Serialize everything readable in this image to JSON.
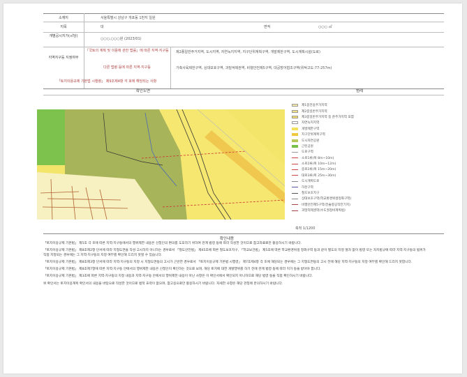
{
  "info": {
    "rows": [
      {
        "label": "소재지",
        "value": "서울특별시 강남구 개포동 1번지 일원"
      },
      {
        "label": "지목",
        "value": "대",
        "extra_label": "면적",
        "extra_value": "○○○ ㎡"
      },
      {
        "label": "개별공시지가(㎡당)",
        "value": "○○○,○○○원 (2023/01)"
      },
      {
        "label": "지역지구등 지정여부",
        "sublabels": [
          "「국토의 계획 및 이용에 관한 법률」에 따른 지역·지구등",
          "다른 법령 등에 따른 지역·지구등",
          "「토지이용규제 기본법 시행령」 제9조제4항 각 호에 해당되는 사항"
        ],
        "values": [
          "제2종일반주거지역, 도시지역, 자연녹지지역, 지구단위계획구역, 개발제한구역, 도시계획시설(도로)",
          "가축사육제한구역, 상대보호구역, 과밀억제권역, 비행안전제5구역, 대공방어협조구역(위탁고도:77-257m)"
        ]
      }
    ],
    "map_title": "확인도면",
    "legend_title": "범례"
  },
  "legend": [
    {
      "label": "제1종전용주거지역",
      "color": "#f4e9a8",
      "kind": "box"
    },
    {
      "label": "제2종일반주거지역",
      "color": "#f0e08a",
      "kind": "box"
    },
    {
      "label": "제3종일반주거지역 등 준주거지역 포함",
      "color": "#f8dc6a",
      "kind": "box"
    },
    {
      "label": "자연녹지지역",
      "color": "#ffffff",
      "kind": "box"
    },
    {
      "label": "개발제한구역",
      "color": "#f3e05c",
      "kind": "fill"
    },
    {
      "label": "지구단위계획구역",
      "color": "#f0c840",
      "kind": "fill"
    },
    {
      "label": "도시자연공원",
      "color": "#b8c85a",
      "kind": "fill"
    },
    {
      "label": "근린공원",
      "color": "#79c04a",
      "kind": "fill"
    },
    {
      "label": "도로구역",
      "color": "#999999",
      "kind": "line"
    },
    {
      "label": "소로1류(폭 8m~10m)",
      "color": "#cc4444",
      "kind": "line"
    },
    {
      "label": "소로2류(폭 10m~12m)",
      "color": "#cc4444",
      "kind": "line"
    },
    {
      "label": "중로2류(폭 15m~20m)",
      "color": "#cc4444",
      "kind": "line"
    },
    {
      "label": "대로3류(폭 25m~30m)",
      "color": "#cc4444",
      "kind": "line"
    },
    {
      "label": "도시계획도로",
      "color": "#888888",
      "kind": "line"
    },
    {
      "label": "하천구역",
      "color": "#5555aa",
      "kind": "line"
    },
    {
      "label": "철도보호지구",
      "color": "#555555",
      "kind": "line"
    },
    {
      "label": "상대보호구역(학교환경위생정화구역)",
      "color": "#888888",
      "kind": "line"
    },
    {
      "label": "비행안전제5구역(전술항공작전기지)",
      "color": "#aa4444",
      "kind": "line"
    },
    {
      "label": "과밀억제권역(수도권정비계획법)",
      "color": "#aa4444",
      "kind": "line"
    }
  ],
  "scale_text": "축척 1/1200",
  "notes_title": "확인내용",
  "notes": [
    "「토지이용규제 기본법」 제5조 각 호에 따른 지역·지구등에서의 행위제한 내용은 신청인의 편의를 도모하기 위하여 관계 법령 등에 따라 작성한 것이므로 참고자료로만 활용하시기 바랍니다.",
    "「토지이용규제 기본법」 제8조제2항 단서에 따라 지형도면을 작성·고시하지 아니하는 경우로서 「철도안전법」 제45조에 따른 철도보호지구, 「학교보건법」 제5조에 따른 학교환경위생 정화구역 등과 같이 별도의 지정 절차 없이 법령 또는 자치법규에 따라 지역·지구등의 범위가 직접 지정되는 경우에는 그 지역·지구등의 지정 여부를 확인해 드리지 못할 수 있습니다.",
    "「토지이용규제 기본법」 제8조제3항 단서에 따라 지역·지구등의 지정 시 지형도면등의 고시가 곤란한 경우로서 「토지이용규제 기본법 시행령」 제7조제4항 각 호에 해당되는 경우에는 그 지형도면등의 고시 전에 해당 지역·지구등의 지정 여부를 확인해 드리지 못합니다.",
    "「토지이용규제 기본법」 제8조제7항에 따른 지역·지구등 안에서의 행위제한 내용은 신청인이 확인하는 것으로 보며, 해당 토지에 대한 개발행위를 하기 전에 관계 법령 등에 따라 허가 등을 받아야 합니다.",
    "「토지이용규제 기본법」 제3조에 따른 지역·지구등의 지정 내용과 지역·지구등 안에서의 행위제한 내용이 아닌 사항은 이 확인서에서 확인되지 아니하므로 해당 법령 등을 직접 확인하시기 바랍니다.",
    "위 확인서는 토지이용계획 확인서의 내용을 바탕으로 작성한 것이므로 법적 효력이 없으며, 참고용으로만 활용하시기 바랍니다. 자세한 사항은 해당 관청에 문의하시기 바랍니다."
  ]
}
